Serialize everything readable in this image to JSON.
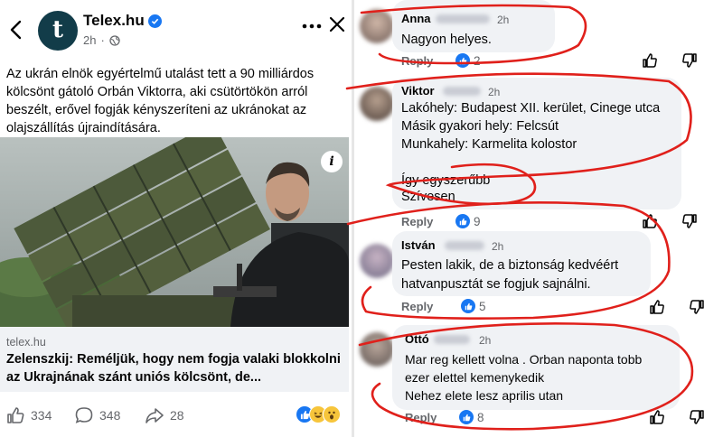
{
  "post": {
    "page_name": "Telex.hu",
    "time": "2h",
    "text": "Az ukrán elnök egyértelmű utalást tett a 90 milliárdos kölcsönt gátoló Orbán Viktorra, aki csütörtökön arról beszélt, erővel fogják kényszeríteni az ukránokat az olajszállítás újraindítására.",
    "link_domain": "telex.hu",
    "link_title": "Zelenszkij: Reméljük, hogy nem fogja valaki blokkolni az Ukrajnának szánt uniós kölcsönt, de...",
    "like_count": "334",
    "comment_count": "348",
    "share_count": "28",
    "icons": [
      "back-arrow-icon",
      "verified-icon",
      "globe-icon",
      "more-icon",
      "close-icon",
      "info-icon",
      "like-icon",
      "comment-icon",
      "share-icon"
    ]
  },
  "comments": [
    {
      "name": "Anna",
      "time": "2h",
      "lines": [
        "Nagyon helyes."
      ],
      "reply_label": "Reply",
      "likes": "2"
    },
    {
      "name": "Viktor",
      "time": "2h",
      "lines": [
        "Lakóhely: Budapest XII. kerület, Cinege utca",
        "Másik gyakori hely: Felcsút",
        "Munkahely: Karmelita kolostor",
        "",
        "Így egyszerűbb",
        "Szívesen"
      ],
      "reply_label": "Reply",
      "likes": "9"
    },
    {
      "name": "István",
      "time": "2h",
      "lines": [
        "Pesten lakik, de a biztonság kedvéért",
        "hatvanpusztát se fogjuk sajnálni."
      ],
      "reply_label": "Reply",
      "likes": "5"
    },
    {
      "name": "Ottó",
      "time": "2h",
      "lines": [
        "Mar reg kellett volna . Orban naponta tobb",
        "ezer elettel kemenykedik",
        "Nehez elete lesz aprilis utan"
      ],
      "reply_label": "Reply",
      "likes": "8"
    }
  ],
  "colors": {
    "accent": "#1877f2",
    "annotation_red": "#e0201b",
    "brand_logo": "#123c49"
  }
}
